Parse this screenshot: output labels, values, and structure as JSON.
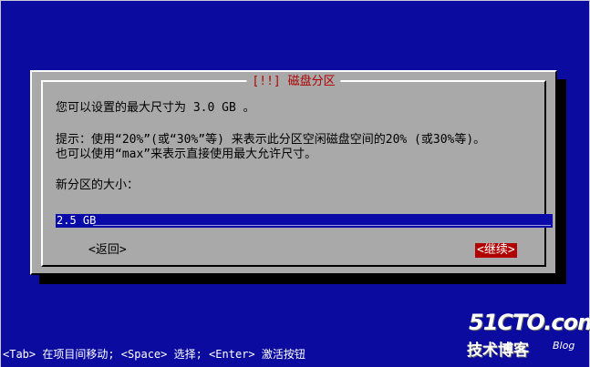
{
  "dialog": {
    "title": "[!!] 磁盘分区",
    "message": "您可以设置的最大尺寸为 3.0 GB 。",
    "tip_line1": "提示：使用“20%”(或“30%”等) 来表示此分区空闲磁盘空间的20% (或30%等)。",
    "tip_line2": "也可以使用“max”来表示直接使用最大允许尺寸。",
    "field_label": "新分区的大小：",
    "size_value": "2.5 GB",
    "back_label": "<返回>",
    "continue_label": "<继续>"
  },
  "footer_hint": "<Tab> 在项目间移动; <Space> 选择; <Enter> 激活按钮",
  "watermark": {
    "main": "51CTO.com",
    "sub": "技术博客",
    "blog": "Blog"
  },
  "colors": {
    "background": "#0b0ba0",
    "dialog": "#a9a9a9",
    "title": "#b00000",
    "input_bg": "#0a0aa8",
    "selected_button_bg": "#b00000"
  }
}
